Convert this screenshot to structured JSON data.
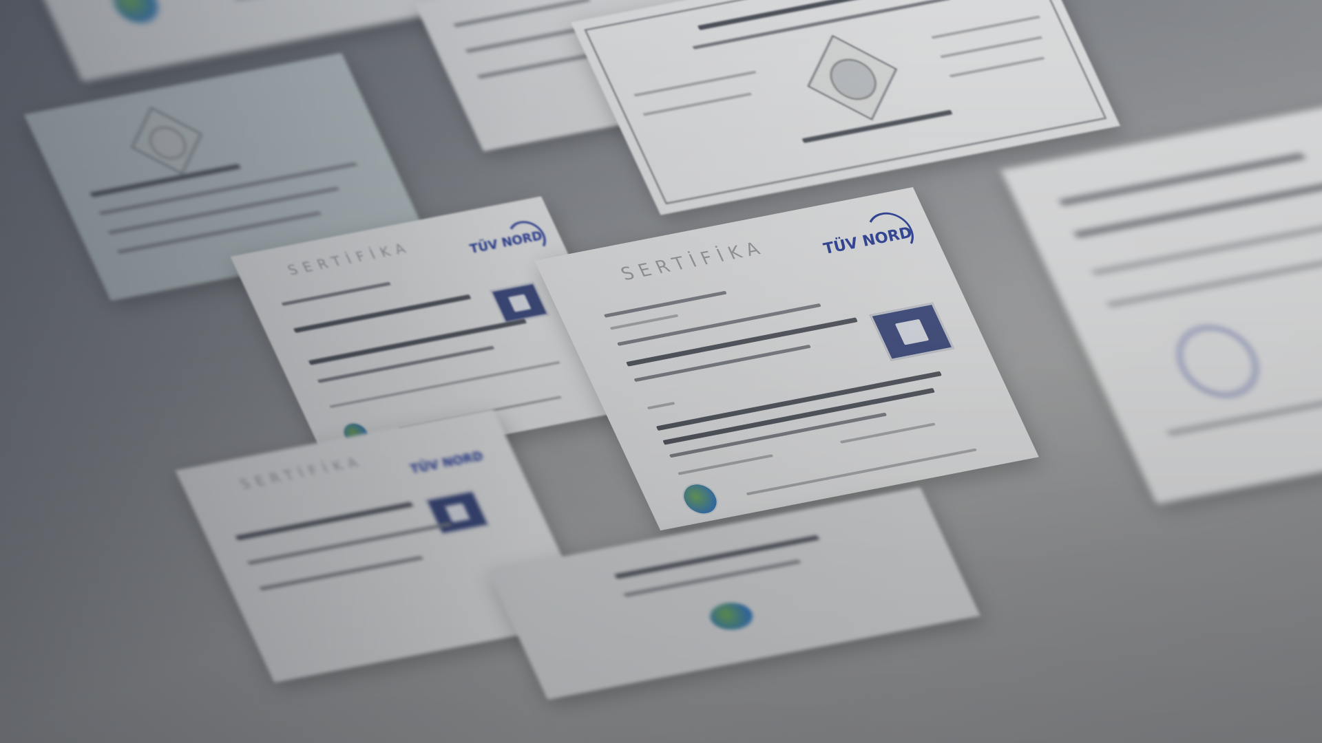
{
  "scene": {
    "description_kind": "blurred background photo of stacked certificate documents",
    "certificate_heading": "SERTİFİKA",
    "issuer_logo_text": "TÜV NORD",
    "colors": {
      "overlay": "#6b7079",
      "paper": "#e4e5e6",
      "logo_blue": "#2a3f9a",
      "badge_blue": "#3c4a7e"
    }
  }
}
